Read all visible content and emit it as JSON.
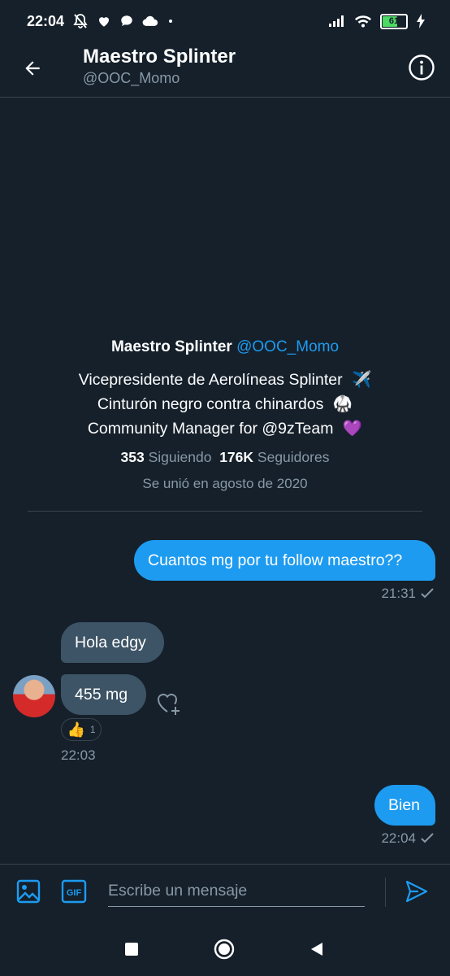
{
  "status_bar": {
    "time": "22:04",
    "battery": "61",
    "left_icons": [
      "mute-icon",
      "heart-icon",
      "chat-icon",
      "cloud-icon",
      "dot-icon"
    ],
    "right_icons": [
      "signal-icon",
      "wifi-icon",
      "battery-icon",
      "charging-icon"
    ]
  },
  "header": {
    "title": "Maestro Splinter",
    "handle": "@OOC_Momo"
  },
  "profile": {
    "name": "Maestro Splinter",
    "handle": "@OOC_Momo",
    "bio": [
      {
        "text": "Vicepresidente de Aerolíneas Splinter",
        "emoji": "✈️"
      },
      {
        "text": "Cinturón negro contra chinardos",
        "emoji": "🥋"
      },
      {
        "text": "Community Manager for @9zTeam",
        "emoji": "💜"
      }
    ],
    "following_count": "353",
    "following_label": "Siguiendo",
    "followers_count": "176K",
    "followers_label": "Seguidores",
    "joined": "Se unió en agosto de 2020"
  },
  "messages": [
    {
      "direction": "out",
      "text": "Cuantos mg por tu follow maestro??",
      "time": "21:31"
    },
    {
      "direction": "in",
      "text": "Hola edgy"
    },
    {
      "direction": "in",
      "text": "455 mg",
      "reaction": {
        "emoji": "👍",
        "count": "1"
      },
      "time": "22:03"
    },
    {
      "direction": "out",
      "text": "Bien",
      "time": "22:04"
    }
  ],
  "composer": {
    "placeholder": "Escribe un mensaje",
    "gif_label": "GIF"
  },
  "colors": {
    "background": "#15202b",
    "accent": "#1d9bf0",
    "incoming_bubble": "#3d5466",
    "muted_text": "#8899a6",
    "divider": "#38444d"
  }
}
